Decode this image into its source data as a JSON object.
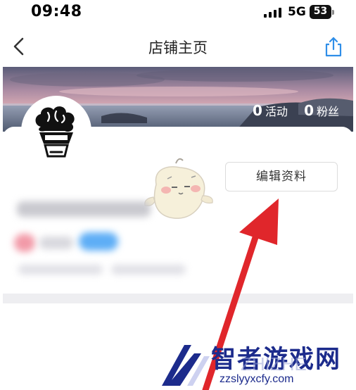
{
  "status_bar": {
    "time": "09:48",
    "network": "5G",
    "battery": "53"
  },
  "nav": {
    "title": "店铺主页",
    "back_icon": "chevron-left-icon",
    "share_icon": "share-icon"
  },
  "shop": {
    "activity_count": "0",
    "activity_label": "活动",
    "fans_count": "0",
    "fans_label": "粉丝",
    "edit_button": "编辑资料"
  },
  "watermark": {
    "brand": "智者游戏网",
    "ghost": "ZHIZHE",
    "url": "zzslyyxcfy.com"
  },
  "colors": {
    "annotation_arrow": "#e0262b",
    "share_icon": "#2f8ee8",
    "watermark": "#1c2b8c"
  }
}
